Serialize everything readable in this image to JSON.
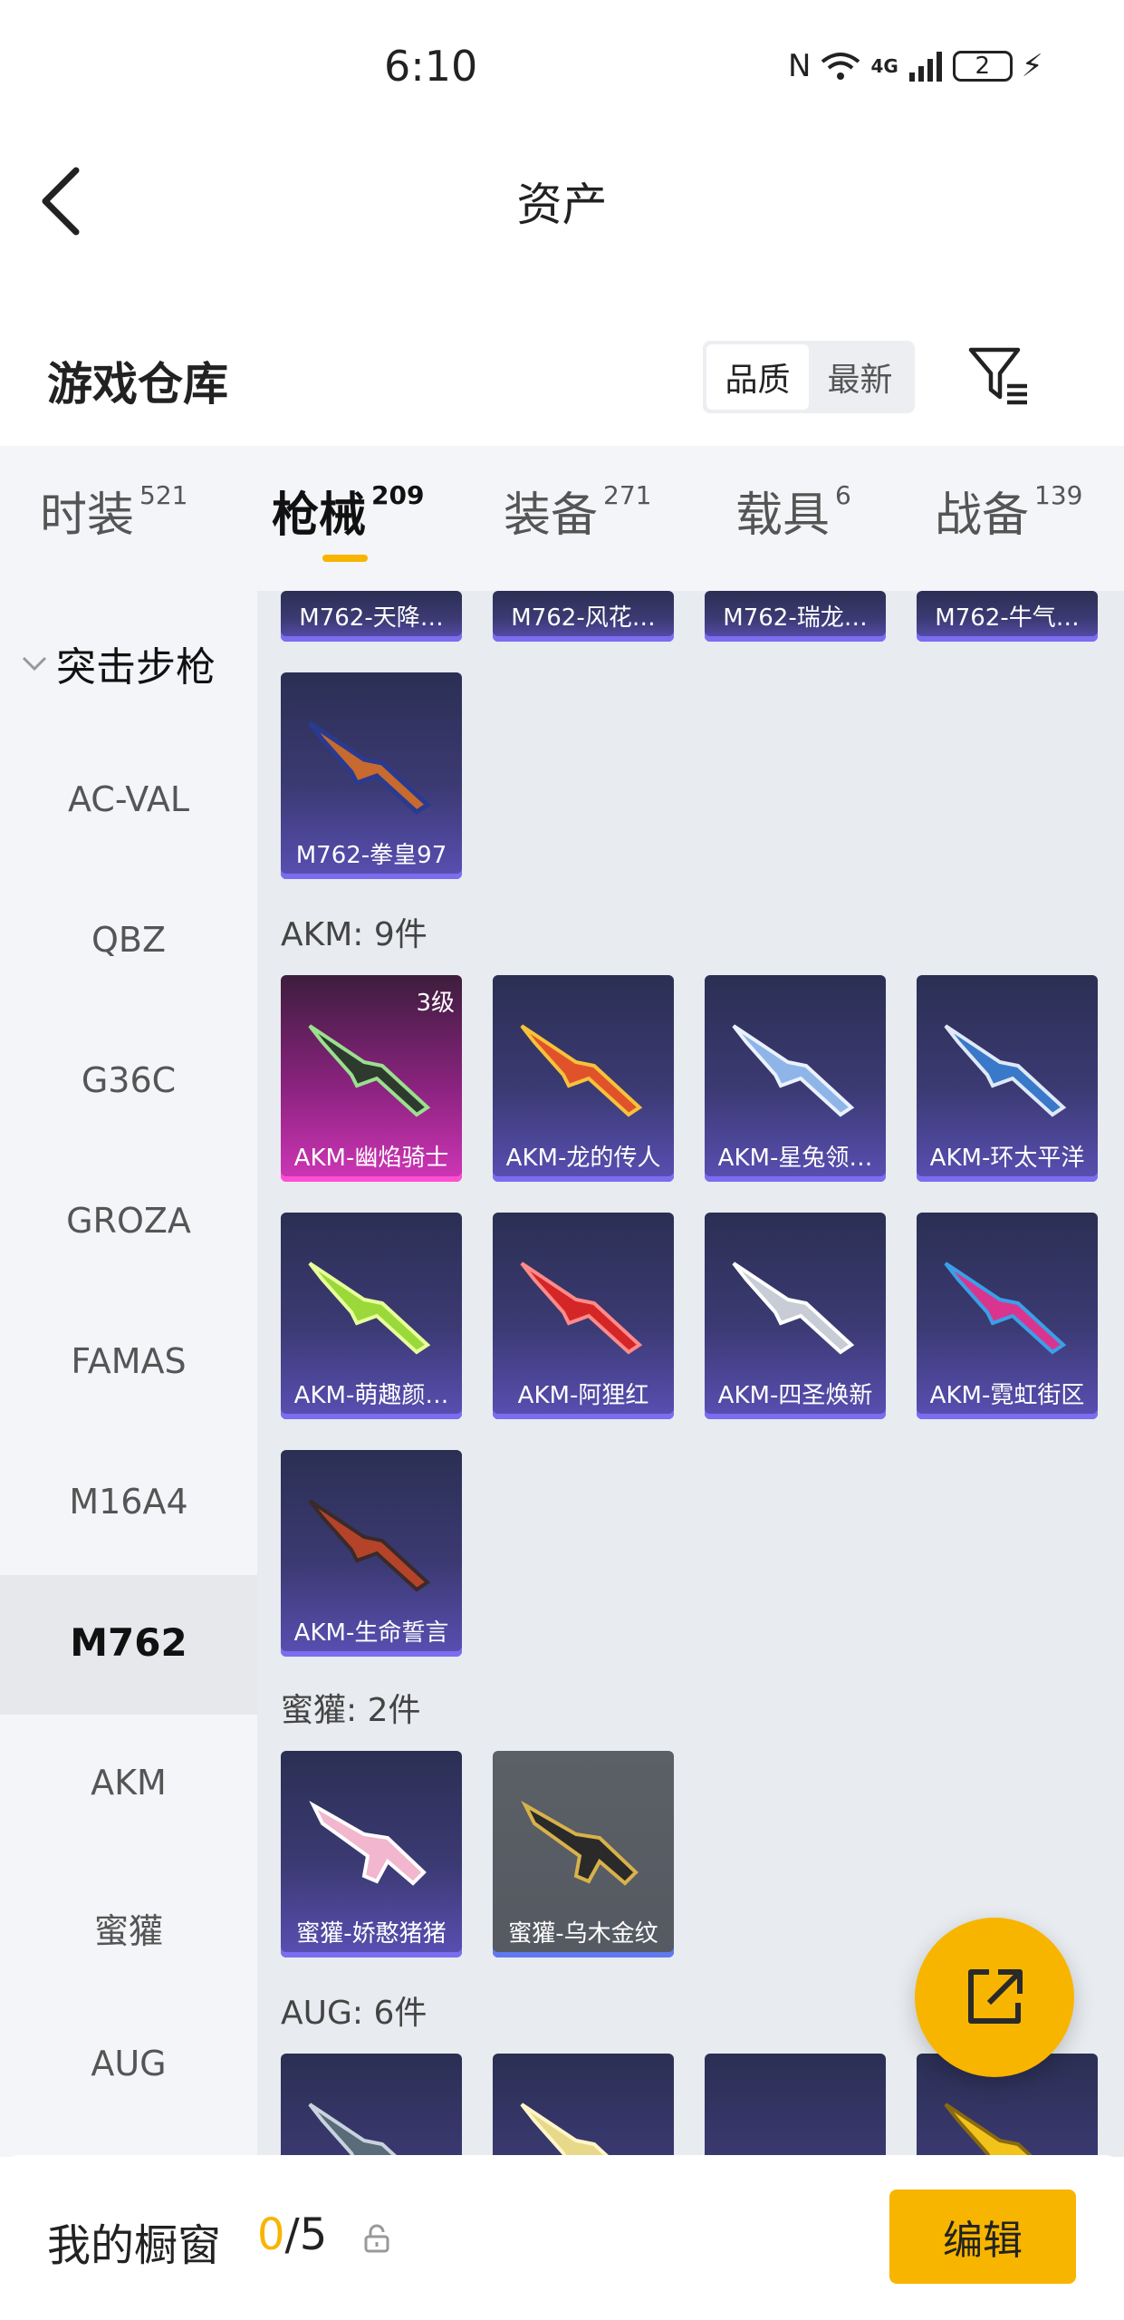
{
  "status_bar": {
    "time": "6:10",
    "network": "4G",
    "battery": "2"
  },
  "header": {
    "title": "资产"
  },
  "warehouse": {
    "title": "游戏仓库",
    "sort_options": [
      "品质",
      "最新"
    ],
    "active_sort": "品质"
  },
  "tabs": [
    {
      "label": "时装",
      "count": "521"
    },
    {
      "label": "枪械",
      "count": "209"
    },
    {
      "label": "装备",
      "count": "271"
    },
    {
      "label": "载具",
      "count": "6"
    },
    {
      "label": "战备",
      "count": "139"
    }
  ],
  "active_tab": "枪械",
  "sidebar": {
    "group": "突击步枪",
    "items": [
      "AC-VAL",
      "QBZ",
      "G36C",
      "GROZA",
      "FAMAS",
      "M16A4",
      "M762",
      "AKM",
      "蜜獾",
      "AUG"
    ],
    "active": "M762"
  },
  "content": {
    "m762_top_row": [
      "M762-天降…",
      "M762-风花…",
      "M762-瑞龙…",
      "M762-牛气…"
    ],
    "m762_last": "M762-拳皇97",
    "groups": [
      {
        "label": "AKM: 9件",
        "items": [
          {
            "name": "AKM-幽焰骑士",
            "badge": "3级"
          },
          {
            "name": "AKM-龙的传人"
          },
          {
            "name": "AKM-星兔领…"
          },
          {
            "name": "AKM-环太平洋"
          },
          {
            "name": "AKM-萌趣颜…"
          },
          {
            "name": "AKM-阿狸红"
          },
          {
            "name": "AKM-四圣焕新"
          },
          {
            "name": "AKM-霓虹街区"
          },
          {
            "name": "AKM-生命誓言"
          }
        ]
      },
      {
        "label": "蜜獾: 2件",
        "items": [
          {
            "name": "蜜獾-娇憨猪猪"
          },
          {
            "name": "蜜獾-乌木金纹"
          }
        ]
      },
      {
        "label": "AUG: 6件",
        "items": []
      }
    ]
  },
  "showcase": {
    "label": "我的橱窗",
    "current": "0",
    "separator_total": "/5"
  },
  "edit_button": "编辑"
}
